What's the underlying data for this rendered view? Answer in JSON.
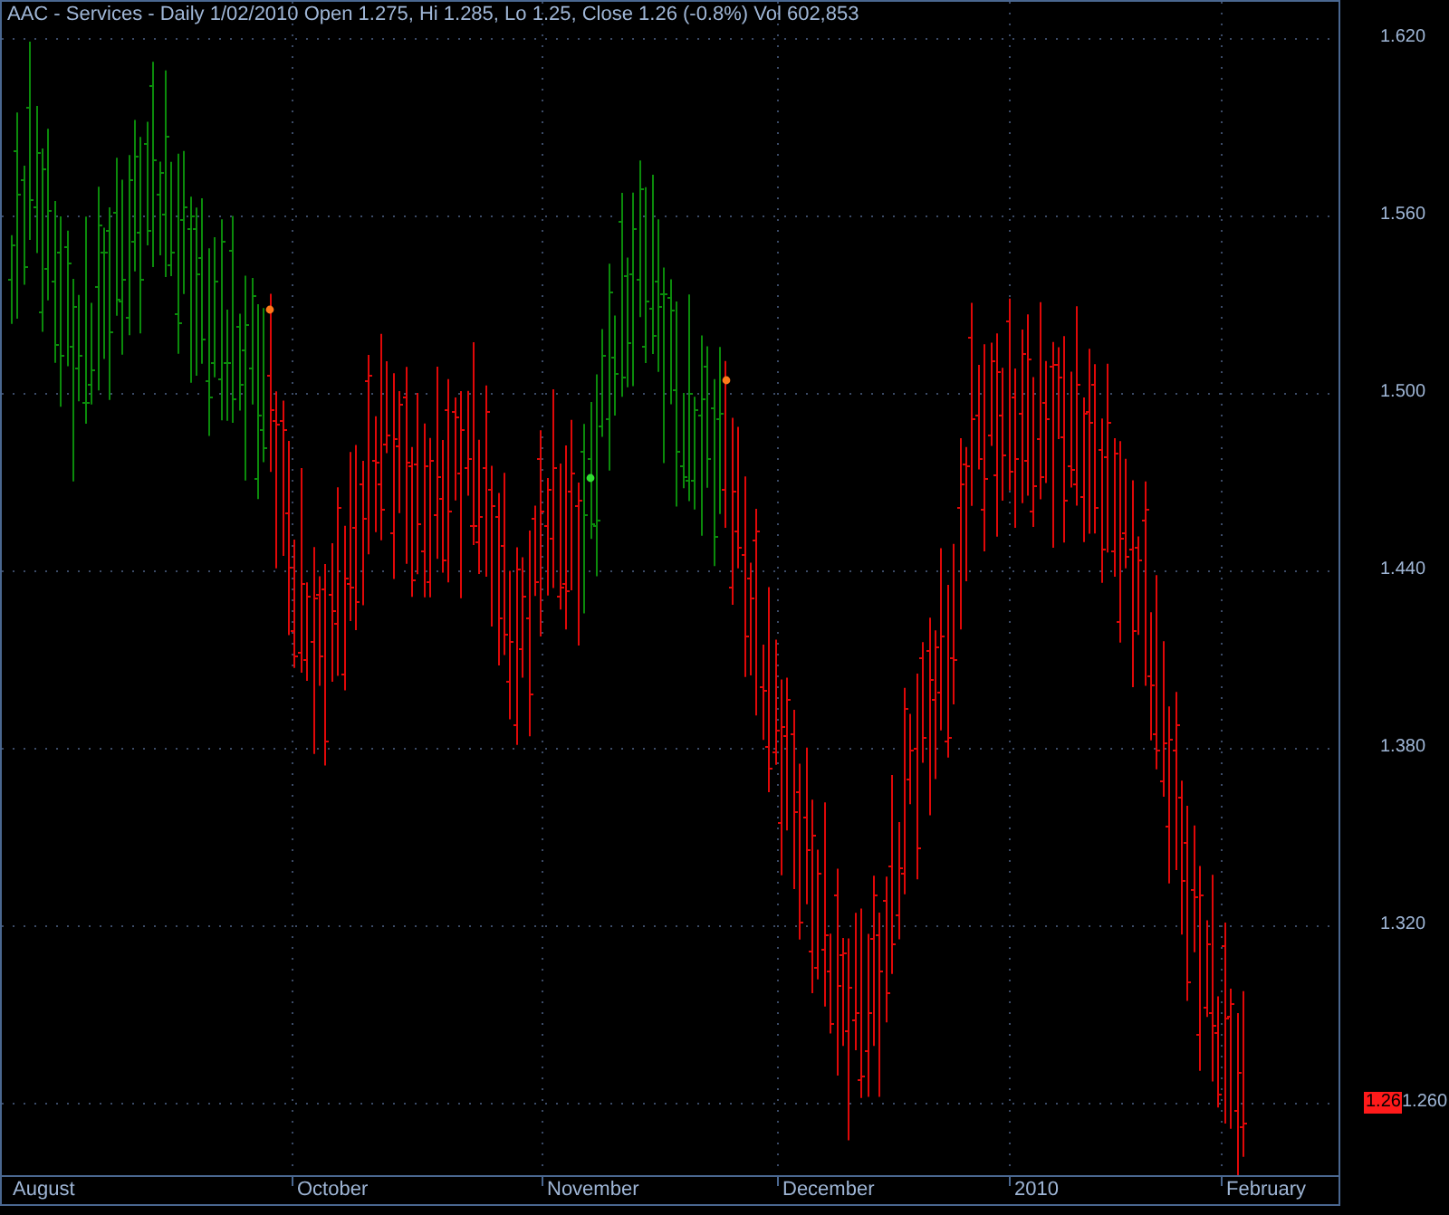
{
  "title": "AAC - Services - Daily 1/02/2010 Open 1.275, Hi 1.285, Lo 1.25, Close 1.26 (-0.8%) Vol 602,853",
  "price_axis": {
    "labels": [
      "1.620",
      "1.560",
      "1.500",
      "1.440",
      "1.380",
      "1.320",
      "1.260"
    ]
  },
  "time_axis": {
    "labels": [
      "August",
      "October",
      "November",
      "December",
      "2010",
      "February"
    ]
  },
  "last_price": "1.26"
}
